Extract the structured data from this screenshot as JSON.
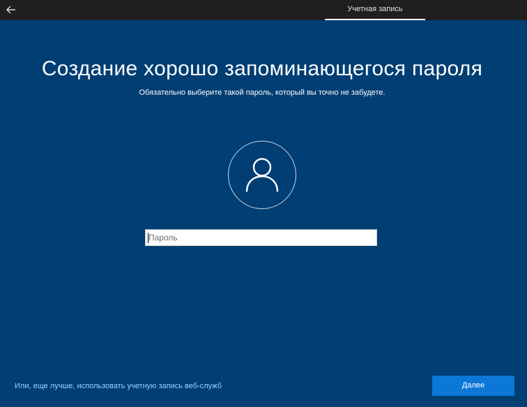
{
  "header": {
    "back_icon": "arrow-left-icon",
    "tab_label": "Учетная запись"
  },
  "main": {
    "title": "Создание хорошо запоминающегося пароля",
    "subtitle": "Обязательно выберите такой пароль, который вы точно не забудете.",
    "avatar_icon": "user-icon",
    "password_placeholder": "Пароль",
    "password_value": ""
  },
  "footer": {
    "alt_link": "Или, еще лучше, использовать учетную запись веб-служб",
    "next_label": "Далее"
  },
  "colors": {
    "background": "#003e73",
    "topbar": "#1f1f1f",
    "accent": "#0b78d7",
    "link": "#9fd1ff"
  }
}
